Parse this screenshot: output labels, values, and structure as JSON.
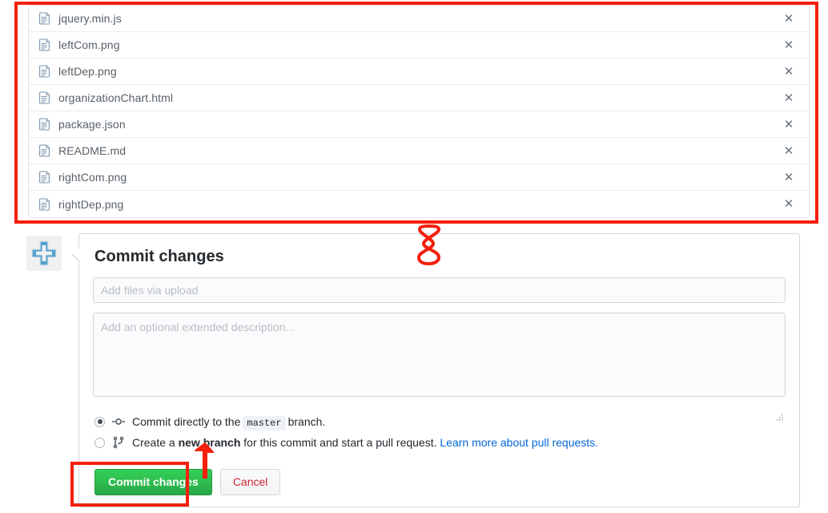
{
  "file_list": {
    "name": "uploaded-files-list",
    "remove_icon": "close-icon",
    "file_icon": "file-icon",
    "remove_label": "✕",
    "files": [
      {
        "name": "jquery.min.js"
      },
      {
        "name": "leftCom.png"
      },
      {
        "name": "leftDep.png"
      },
      {
        "name": "organizationChart.html"
      },
      {
        "name": "package.json"
      },
      {
        "name": "README.md"
      },
      {
        "name": "rightCom.png"
      },
      {
        "name": "rightDep.png"
      }
    ]
  },
  "commit": {
    "avatar_icon": "plus-cross-avatar-icon",
    "title": "Commit changes",
    "summary": {
      "value": "",
      "placeholder": "Add files via upload"
    },
    "description": {
      "value": "",
      "placeholder": "Add an optional extended description..."
    },
    "options": [
      {
        "icon": "git-commit-icon",
        "checked": true,
        "text_before": "Commit directly to the",
        "branch": "master",
        "text_after": "branch."
      },
      {
        "icon": "git-branch-icon",
        "checked": false,
        "text_before": "Create a",
        "bold": "new branch",
        "text_after": "for this commit and start a pull request.",
        "link": "Learn more about pull requests."
      }
    ],
    "commit_button": "Commit changes",
    "cancel_button": "Cancel"
  },
  "annotations": {
    "accent_color": "#f41f0d",
    "file_list_box": "highlight-box-file-list",
    "commit_button_box": "highlight-box-commit-button",
    "hourglass_mark": "hourglass-mark",
    "arrow_mark": "arrow-mark"
  },
  "colors": {
    "commit_green": "#2cbe4e",
    "cancel_red": "#cb2431",
    "link_blue": "#0366d6",
    "avatar_blue": "#54a0cd",
    "annotation_red": "#f41f0d"
  }
}
